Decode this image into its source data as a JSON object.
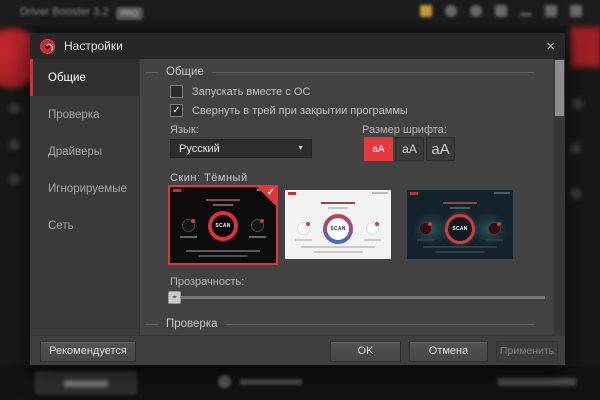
{
  "colors": {
    "accent_red": "#e5383f",
    "selection_red": "#d3303a",
    "dialog_bg": "#3f3f3f",
    "content_bg": "#424242",
    "header_bg": "#272727"
  },
  "background_window": {
    "title": "Driver Booster 3.2",
    "badge": "PRO"
  },
  "icons": {
    "check": "✓",
    "caret_down": "▼",
    "close": "×",
    "slider_grip": "◂▸"
  },
  "dialog": {
    "title": "Настройки",
    "sidebar": {
      "items": [
        {
          "label": "Общие",
          "selected": true
        },
        {
          "label": "Проверка",
          "selected": false
        },
        {
          "label": "Драйверы",
          "selected": false
        },
        {
          "label": "Игнорируемые",
          "selected": false
        },
        {
          "label": "Сеть",
          "selected": false
        }
      ]
    },
    "general": {
      "section_header": "Общие",
      "checkbox_autostart": {
        "label": "Запускать вместе с ОС",
        "checked": false
      },
      "checkbox_tray": {
        "label": "Свернуть в трей при закрытии программы",
        "checked": true
      },
      "language_label": "Язык:",
      "language_value": "Русский",
      "font_size_label": "Размер шрифта:",
      "font_size_small": "aA",
      "font_size_medium": "aA",
      "font_size_large": "aA",
      "skin_label": "Скин: Тёмный",
      "skin_scan_text": "SCAN",
      "skins": [
        {
          "name": "dark",
          "selected": true
        },
        {
          "name": "light",
          "selected": false
        },
        {
          "name": "navy",
          "selected": false
        }
      ],
      "transparency_label": "Прозрачность:"
    },
    "next_section_header": "Проверка",
    "footer": {
      "recommended": "Рекомендуется",
      "ok": "OK",
      "cancel": "Отмена",
      "apply": "Применить"
    }
  }
}
